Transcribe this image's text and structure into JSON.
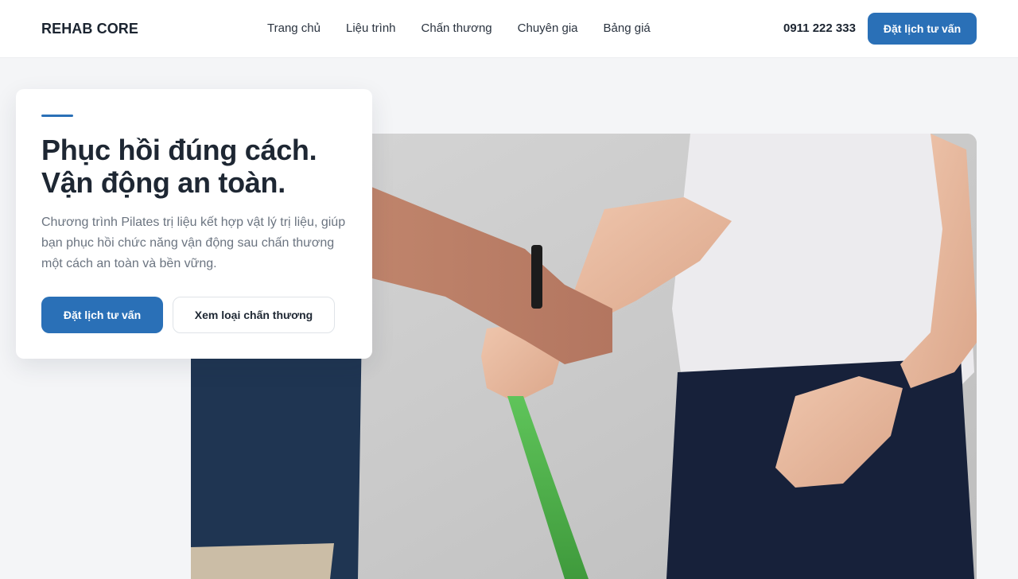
{
  "header": {
    "logo": "REHAB CORE",
    "nav": [
      {
        "label": "Trang chủ"
      },
      {
        "label": "Liệu trình"
      },
      {
        "label": "Chấn thương"
      },
      {
        "label": "Chuyên gia"
      },
      {
        "label": "Bảng giá"
      }
    ],
    "phone": "0911 222 333",
    "cta_label": "Đặt lịch tư vấn"
  },
  "hero": {
    "headline_line1": "Phục hồi đúng cách.",
    "headline_line2": "Vận động an toàn.",
    "lead": "Chương trình Pilates trị liệu kết hợp vật lý trị liệu, giúp bạn phục hồi chức năng vận động sau chấn thương một cách an toàn và bền vững.",
    "primary_button": "Đặt lịch tư vấn",
    "secondary_button": "Xem loại chấn thương"
  },
  "colors": {
    "brand": "#2a70b7",
    "text_dark": "#1e2733",
    "text_muted": "#6b7480",
    "page_bg": "#f4f5f7"
  }
}
